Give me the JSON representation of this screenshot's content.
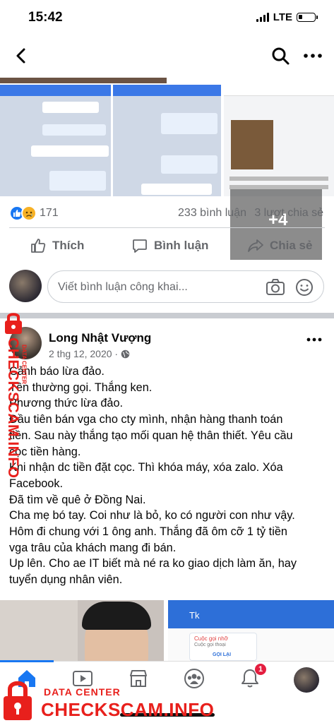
{
  "status_bar": {
    "time": "15:42",
    "network": "LTE"
  },
  "photo_grid": {
    "more_count": "+4"
  },
  "stats": {
    "reactions": "171",
    "comments": "233 bình luận",
    "shares": "3 lượt chia sẻ"
  },
  "actions": {
    "like": "Thích",
    "comment": "Bình luận",
    "share": "Chia sẻ"
  },
  "comment_box": {
    "placeholder": "Viết bình luận công khai..."
  },
  "post": {
    "author": "Long Nhật Vượng",
    "date": "2 thg 12, 2020 ·",
    "lines": [
      "Cảnh báo lừa đảo.",
      "Tên thường gọi. Thắng ken.",
      "Phương thức lừa đảo.",
      "Đầu tiên bán vga cho cty mình, nhận hàng thanh toán",
      "tiền. Sau này thắng tạo mối quan hệ thân thiết. Yêu cầu",
      "cọc tiền hàng.",
      "Khi nhận dc tiền đặt cọc. Thì khóa máy, xóa zalo. Xóa",
      "Facebook.",
      "Đã tìm về quê ở Đồng Nai.",
      "Cha mẹ bó tay. Coi như là bỏ, ko có người con như vậy.",
      "Hôm đi chung với 1 ông anh. Thắng đã ôm cỡ 1 tỷ tiền",
      "vga trâu của khách mang đi bán.",
      "Up lên. Cho ae IT biết mà né ra ko giao dịch làm ăn, hay",
      "tuyển dụng nhân viên."
    ]
  },
  "post_photo_preview": {
    "chat_title": "Tk",
    "missed_call": "Cuộc gọi nhỡ",
    "call_sub": "Cuộc gọi thoại",
    "call_back": "GỌI LẠI"
  },
  "bottom_nav": {
    "notification_badge": "1"
  },
  "watermark": {
    "small": "DATA CENTER",
    "big": "CHECKSCAM.INFO",
    "vertical_big": "CHECKSCAM.INFO",
    "vertical_small": "DATA CENTER"
  },
  "colors": {
    "accent": "#1877f2",
    "watermark": "#e8201c",
    "secondary_text": "#65676b"
  }
}
